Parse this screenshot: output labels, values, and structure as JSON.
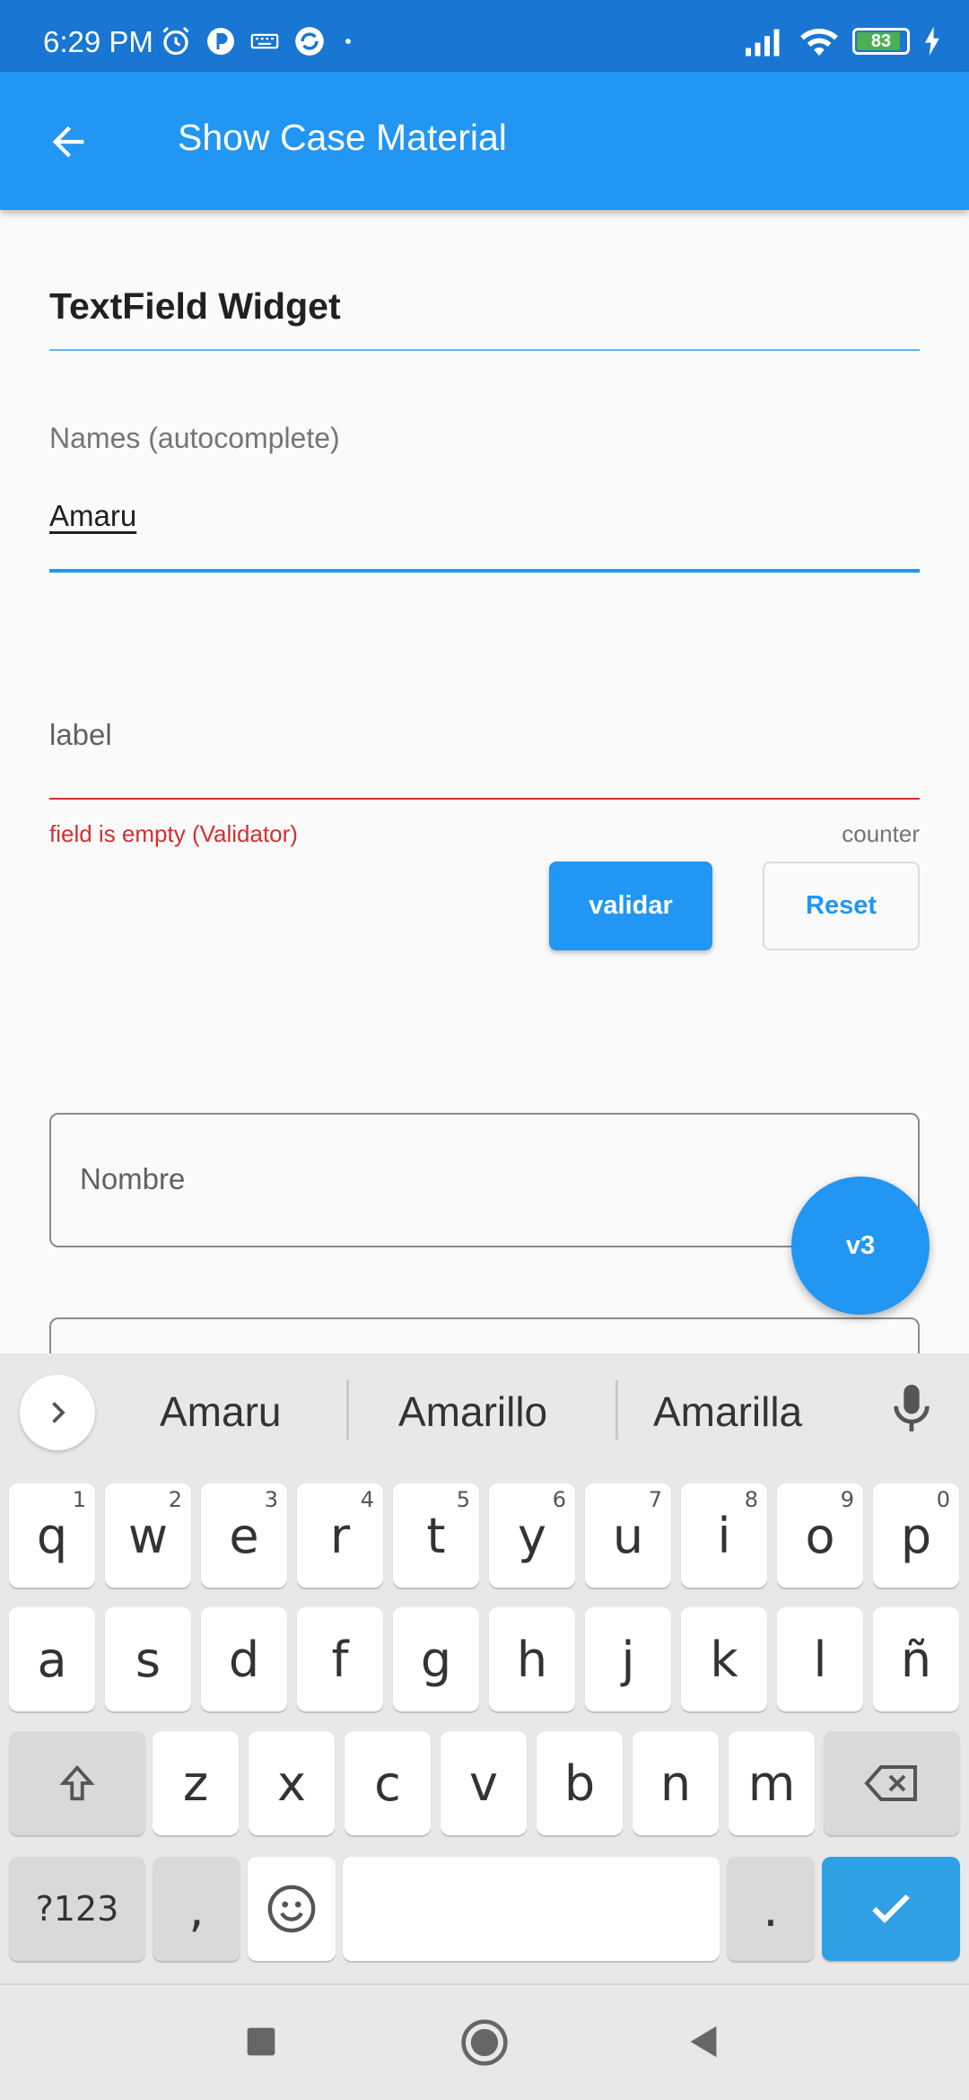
{
  "status_bar": {
    "time": "6:29 PM",
    "battery": "83",
    "battery_level_percent": 83,
    "icons": [
      "alarm-icon",
      "app-icon",
      "keyboard-icon",
      "sync-icon",
      "dot-icon",
      "signal-icon",
      "wifi-icon",
      "battery-icon",
      "charging-icon"
    ]
  },
  "app_bar": {
    "title": "Show Case Material",
    "back_icon": "arrow-back-icon"
  },
  "content": {
    "section_title": "TextField Widget",
    "names_field": {
      "label": "Names (autocomplete)",
      "value": "Amaru"
    },
    "label_field": {
      "label": "label",
      "error": "field is empty (Validator)",
      "counter": "counter"
    },
    "validar_button": "validar",
    "reset_button": "Reset",
    "nombre_field": {
      "placeholder": "Nombre"
    },
    "fab_label": "v3"
  },
  "keyboard": {
    "suggestions": [
      "Amaru",
      "Amarillo",
      "Amarilla"
    ],
    "row1": [
      {
        "k": "q",
        "n": "1"
      },
      {
        "k": "w",
        "n": "2"
      },
      {
        "k": "e",
        "n": "3"
      },
      {
        "k": "r",
        "n": "4"
      },
      {
        "k": "t",
        "n": "5"
      },
      {
        "k": "y",
        "n": "6"
      },
      {
        "k": "u",
        "n": "7"
      },
      {
        "k": "i",
        "n": "8"
      },
      {
        "k": "o",
        "n": "9"
      },
      {
        "k": "p",
        "n": "0"
      }
    ],
    "row2": [
      "a",
      "s",
      "d",
      "f",
      "g",
      "h",
      "j",
      "k",
      "l",
      "ñ"
    ],
    "row3": [
      "z",
      "x",
      "c",
      "v",
      "b",
      "n",
      "m"
    ],
    "symbols_key": "?123",
    "comma_key": ",",
    "period_key": "."
  },
  "colors": {
    "primary": "#2196f3",
    "status_bar": "#1976d2",
    "error": "#d32f2f",
    "enter_key": "#2f9fe6"
  }
}
